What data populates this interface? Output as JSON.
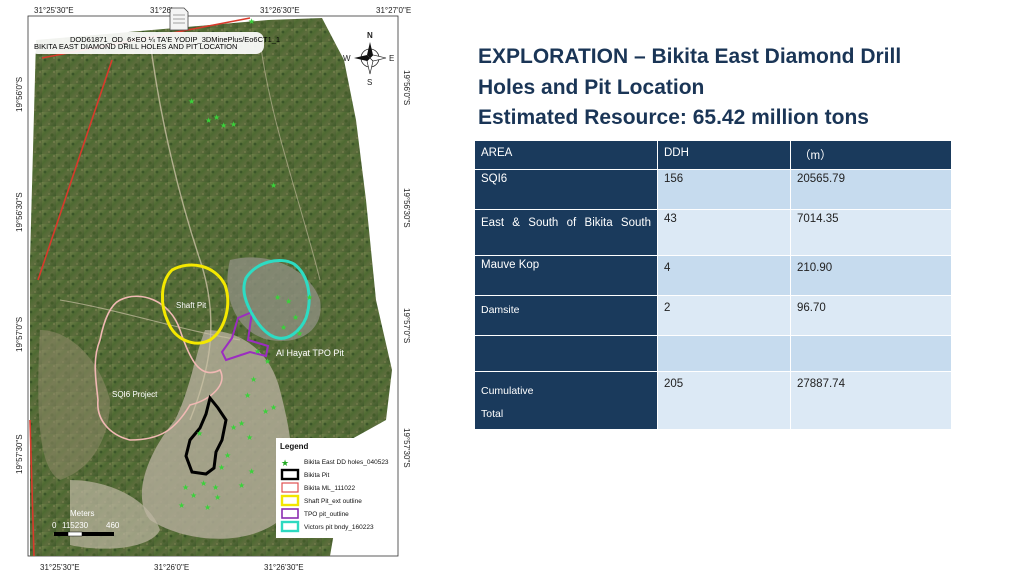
{
  "map": {
    "doc_id": "DOD61871_OD_6×EO ¼ TA'E YODIP_3DMinePlus/Eo6CT1_1",
    "map_title": "BIKITA EAST DIAMOND DRILL HOLES AND PIT LOCATION",
    "top_coords": [
      "31°25'30\"E",
      "31°26'",
      "31°26'30\"E",
      "31°27'0\"E"
    ],
    "bottom_coords": [
      "31°25'30\"E",
      "31°26'0\"E",
      "31°26'30\"E"
    ],
    "left_coords": [
      "19°56'0\"S",
      "19°56'30\"S",
      "19°57'0\"S",
      "19°57'30\"S"
    ],
    "right_coords": [
      "19°56'0\"S",
      "19°56'30\"S",
      "19°57'0\"S",
      "19°57'30\"S"
    ],
    "labels": {
      "shaft_pit": "Shaft Pit",
      "al_hayat": "Al Hayat TPO Pit",
      "sqi6_project": "SQI6 Project"
    },
    "compass": {
      "n": "N",
      "s": "S",
      "e": "E",
      "w": "W"
    },
    "scale": {
      "title": "Meters",
      "ticks": [
        "0",
        "115230",
        "460"
      ]
    },
    "legend": {
      "title": "Legend",
      "items": [
        {
          "label": "Bikita East DD holes_040523",
          "color": "#22aa22"
        },
        {
          "label": "Bikita Pit",
          "color": "#000000"
        },
        {
          "label": "Bikita ML_111022",
          "color": "#e05050"
        },
        {
          "label": "Shaft Pit_ext outline",
          "color": "#f2e600"
        },
        {
          "label": "TPO pit_outline",
          "color": "#8a2db0"
        },
        {
          "label": "Victors pit bndy_160223",
          "color": "#2dd9c0"
        }
      ]
    }
  },
  "title_lines": [
    "EXPLORATION – Bikita East Diamond Drill",
    "Holes and Pit Location",
    "Estimated Resource: 65.42 million tons"
  ],
  "table": {
    "headers": [
      "AREA",
      "DDH",
      "（m）"
    ],
    "rows": [
      {
        "area": "SQI6",
        "ddh": "156",
        "m": "20565.79"
      },
      {
        "area": "East & South of Bikita South",
        "ddh": "43",
        "m": "7014.35"
      },
      {
        "area": "Mauve Kop",
        "ddh": "4",
        "m": "210.90"
      },
      {
        "area": "Damsite",
        "ddh": "2",
        "m": "96.70"
      },
      {
        "area": "",
        "ddh": "",
        "m": ""
      },
      {
        "area": "Cumulative Total",
        "ddh": "205",
        "m": "27887.74"
      }
    ]
  }
}
